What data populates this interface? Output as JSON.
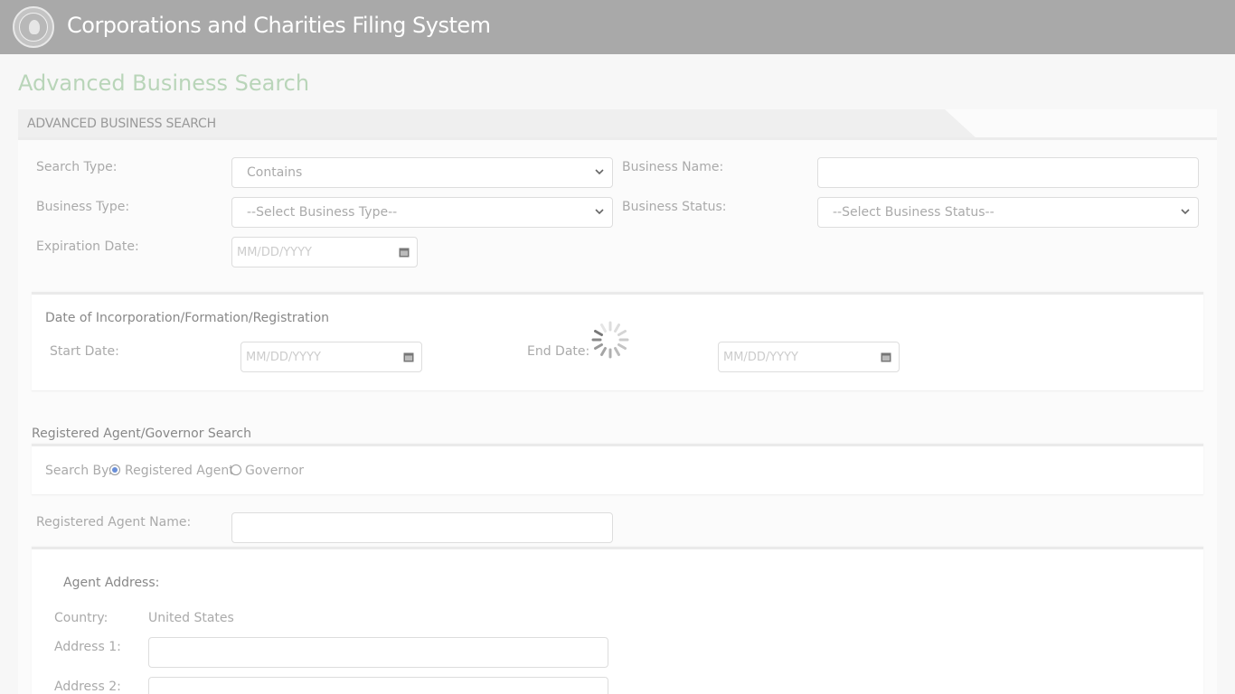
{
  "header": {
    "app_title": "Corporations and Charities Filing System",
    "seal_icon": "state-seal-icon"
  },
  "page": {
    "title": "Advanced Business Search"
  },
  "panel": {
    "tab_label": "ADVANCED BUSINESS SEARCH"
  },
  "form": {
    "search_type": {
      "label": "Search Type:",
      "value": "Contains"
    },
    "business_name": {
      "label": "Business Name:",
      "value": ""
    },
    "business_type": {
      "label": "Business Type:",
      "value": "--Select Business Type--"
    },
    "business_status": {
      "label": "Business Status:",
      "value": "--Select Business Status--"
    },
    "expiration_date": {
      "label": "Expiration Date:",
      "placeholder": "MM/DD/YYYY"
    }
  },
  "incorporation": {
    "heading": "Date of Incorporation/Formation/Registration",
    "start": {
      "label": "Start Date:",
      "placeholder": "MM/DD/YYYY"
    },
    "end": {
      "label": "End Date:",
      "placeholder": "MM/DD/YYYY"
    }
  },
  "agent_search": {
    "heading": "Registered Agent/Governor Search",
    "search_by_label": "Search By:",
    "option_agent": "Registered Agent",
    "option_governor": "Governor",
    "selected": "Registered Agent",
    "agent_name_label": "Registered Agent Name:"
  },
  "agent_address": {
    "heading": "Agent Address:",
    "country_label": "Country:",
    "country_value": "United States",
    "address1_label": "Address 1:",
    "address2_label": "Address 2:"
  },
  "colors": {
    "header_bg": "#a9a9a9",
    "page_title": "#b9d5b9",
    "radio_selected": "#6a8fd8"
  }
}
